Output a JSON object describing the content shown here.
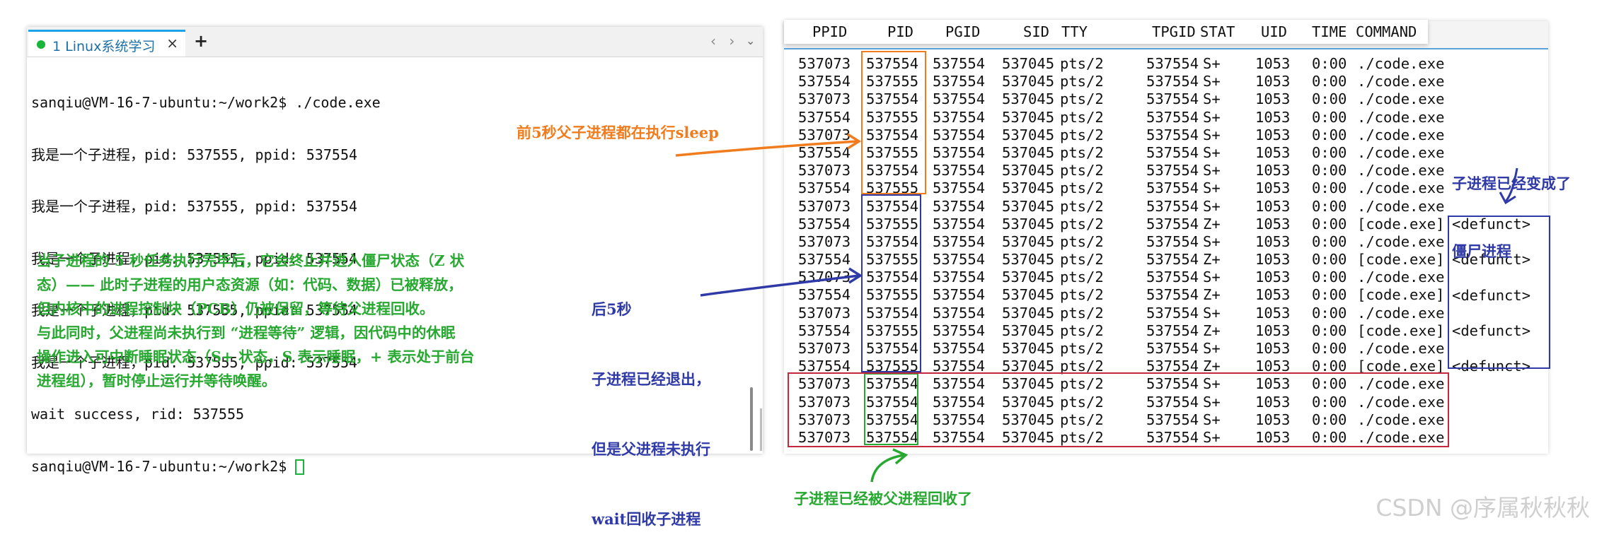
{
  "left_terminal": {
    "tab_label": "1 Linux系统学习",
    "tab_close": "×",
    "new_tab": "+",
    "nav_arrows": "‹ ›",
    "nav_chevron": "⌄",
    "lines": [
      "sanqiu@VM-16-7-ubuntu:~/work2$ ./code.exe",
      "我是一个子进程，pid: 537555, ppid: 537554",
      "我是一个子进程，pid: 537555, ppid: 537554",
      "我是一个子进程，pid: 537555, ppid: 537554",
      "我是一个子进程，pid: 537555, ppid: 537554",
      "我是一个子进程，pid: 537555, ppid: 537554",
      "wait success, rid: 537555",
      "sanqiu@VM-16-7-ubuntu:~/work2$ "
    ]
  },
  "note_left": [
    "当子进程的 5 秒任务执行完毕后，它会终止并进入僵尸状态（Z 状",
    "态）—— 此时子进程的用户态资源（如：代码、数据）已被释放，",
    "但内核中的进程控制块（PCB）仍被保留，等待父进程回收。",
    "与此同时，父进程尚未执行到 “进程等待” 逻辑，因代码中的休眠",
    "操作进入可中断睡眠状态（S+ 状态，S 表示睡眠，+ 表示处于前台",
    "进程组），暂时停止运行并等待唤醒。"
  ],
  "ps_header": [
    "PPID",
    "PID",
    "PGID",
    "SID",
    "TTY",
    "TPGID",
    "STAT",
    "UID",
    "TIME",
    "COMMAND"
  ],
  "ps_rows": [
    [
      "537073",
      "537554",
      "537554",
      "537045",
      "pts/2",
      "537554",
      "S+",
      "1053",
      "0:00",
      "./code.exe"
    ],
    [
      "537554",
      "537555",
      "537554",
      "537045",
      "pts/2",
      "537554",
      "S+",
      "1053",
      "0:00",
      "./code.exe"
    ],
    [
      "537073",
      "537554",
      "537554",
      "537045",
      "pts/2",
      "537554",
      "S+",
      "1053",
      "0:00",
      "./code.exe"
    ],
    [
      "537554",
      "537555",
      "537554",
      "537045",
      "pts/2",
      "537554",
      "S+",
      "1053",
      "0:00",
      "./code.exe"
    ],
    [
      "537073",
      "537554",
      "537554",
      "537045",
      "pts/2",
      "537554",
      "S+",
      "1053",
      "0:00",
      "./code.exe"
    ],
    [
      "537554",
      "537555",
      "537554",
      "537045",
      "pts/2",
      "537554",
      "S+",
      "1053",
      "0:00",
      "./code.exe"
    ],
    [
      "537073",
      "537554",
      "537554",
      "537045",
      "pts/2",
      "537554",
      "S+",
      "1053",
      "0:00",
      "./code.exe"
    ],
    [
      "537554",
      "537555",
      "537554",
      "537045",
      "pts/2",
      "537554",
      "S+",
      "1053",
      "0:00",
      "./code.exe"
    ],
    [
      "537073",
      "537554",
      "537554",
      "537045",
      "pts/2",
      "537554",
      "S+",
      "1053",
      "0:00",
      "./code.exe"
    ],
    [
      "537554",
      "537555",
      "537554",
      "537045",
      "pts/2",
      "537554",
      "Z+",
      "1053",
      "0:00",
      "[code.exe]"
    ],
    [
      "537073",
      "537554",
      "537554",
      "537045",
      "pts/2",
      "537554",
      "S+",
      "1053",
      "0:00",
      "./code.exe"
    ],
    [
      "537554",
      "537555",
      "537554",
      "537045",
      "pts/2",
      "537554",
      "Z+",
      "1053",
      "0:00",
      "[code.exe]"
    ],
    [
      "537073",
      "537554",
      "537554",
      "537045",
      "pts/2",
      "537554",
      "S+",
      "1053",
      "0:00",
      "./code.exe"
    ],
    [
      "537554",
      "537555",
      "537554",
      "537045",
      "pts/2",
      "537554",
      "Z+",
      "1053",
      "0:00",
      "[code.exe]"
    ],
    [
      "537073",
      "537554",
      "537554",
      "537045",
      "pts/2",
      "537554",
      "S+",
      "1053",
      "0:00",
      "./code.exe"
    ],
    [
      "537554",
      "537555",
      "537554",
      "537045",
      "pts/2",
      "537554",
      "Z+",
      "1053",
      "0:00",
      "[code.exe]"
    ],
    [
      "537073",
      "537554",
      "537554",
      "537045",
      "pts/2",
      "537554",
      "S+",
      "1053",
      "0:00",
      "./code.exe"
    ],
    [
      "537554",
      "537555",
      "537554",
      "537045",
      "pts/2",
      "537554",
      "Z+",
      "1053",
      "0:00",
      "[code.exe]"
    ],
    [
      "537073",
      "537554",
      "537554",
      "537045",
      "pts/2",
      "537554",
      "S+",
      "1053",
      "0:00",
      "./code.exe"
    ],
    [
      "537073",
      "537554",
      "537554",
      "537045",
      "pts/2",
      "537554",
      "S+",
      "1053",
      "0:00",
      "./code.exe"
    ],
    [
      "537073",
      "537554",
      "537554",
      "537045",
      "pts/2",
      "537554",
      "S+",
      "1053",
      "0:00",
      "./code.exe"
    ],
    [
      "537073",
      "537554",
      "537554",
      "537045",
      "pts/2",
      "537554",
      "S+",
      "1053",
      "0:00",
      "./code.exe"
    ]
  ],
  "defunct_label": "<defunct>",
  "annotations": {
    "sleep_note": "前5秒父子进程都在执行sleep",
    "after5_note": [
      "后5秒",
      "子进程已经退出，",
      "但是父进程未执行",
      "wait回收子进程"
    ],
    "zombie_note": [
      "子进程已经变成了",
      "僵尸进程"
    ],
    "reaped_note": "子进程已经被父进程回收了"
  },
  "colors": {
    "orange": "#f07c1e",
    "blue": "#2f3aa6",
    "red": "#c4283a",
    "green": "#27a830",
    "tab_accent": "#1aa3e6"
  },
  "watermark": "CSDN @序属秋秋秋"
}
